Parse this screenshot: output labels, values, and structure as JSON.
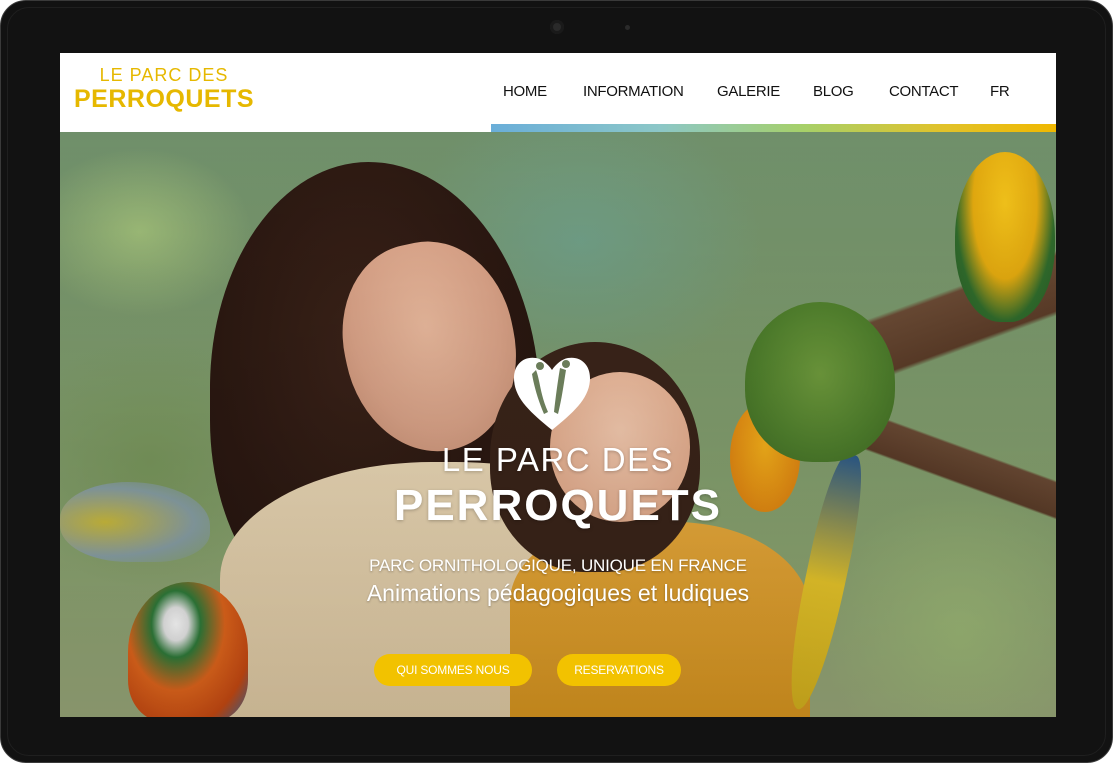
{
  "brand": {
    "logo_line1": "LE PARC DES",
    "logo_line2": "PERROQUETS",
    "color_gold": "#e6b800"
  },
  "nav": {
    "items": [
      {
        "label": "HOME"
      },
      {
        "label": "INFORMATION"
      },
      {
        "label": "GALERIE"
      },
      {
        "label": "BLOG"
      },
      {
        "label": "CONTACT"
      },
      {
        "label": "FR"
      }
    ]
  },
  "hero": {
    "icon": "parrots-heart-logo-icon",
    "title_line1": "LE PARC DES",
    "title_line2": "PERROQUETS",
    "subtitle": "PARC ORNITHOLOGIQUE, UNIQUE EN FRANCE",
    "tagline": "Animations pédagogiques et ludiques",
    "buttons": [
      {
        "label": "QUI SOMMES NOUS"
      },
      {
        "label": "RESERVATIONS"
      }
    ],
    "button_color": "#f2c200"
  }
}
